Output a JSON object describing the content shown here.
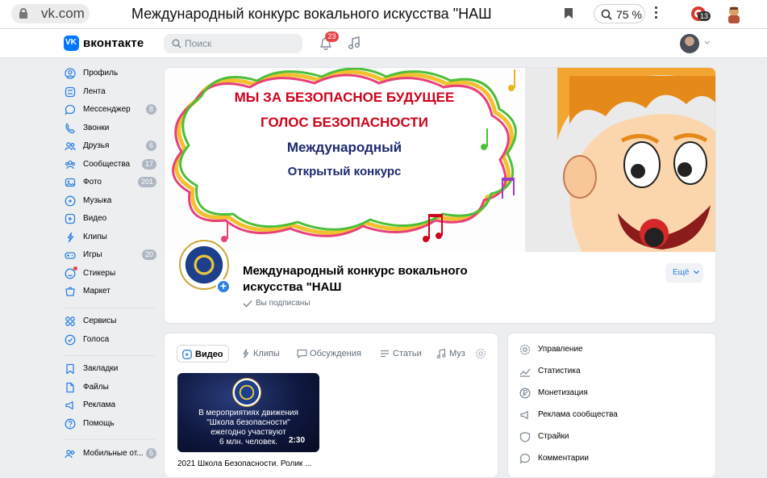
{
  "browser": {
    "url": "vk.com",
    "title": "Международный конкурс вокального искусства \"НАШ",
    "zoom": "75 %",
    "extension_badge": "13"
  },
  "header": {
    "brand": "вконтакте",
    "search_placeholder": "Поиск",
    "notifications_count": "23"
  },
  "nav": {
    "items": [
      {
        "label": "Профиль",
        "icon": "profile-icon"
      },
      {
        "label": "Лента",
        "icon": "feed-icon"
      },
      {
        "label": "Мессенджер",
        "icon": "messenger-icon",
        "count": "8"
      },
      {
        "label": "Звонки",
        "icon": "phone-icon"
      },
      {
        "label": "Друзья",
        "icon": "friends-icon",
        "count": "6"
      },
      {
        "label": "Сообщества",
        "icon": "communities-icon",
        "count": "17"
      },
      {
        "label": "Фото",
        "icon": "photo-icon",
        "count": "201"
      },
      {
        "label": "Музыка",
        "icon": "music-icon"
      },
      {
        "label": "Видео",
        "icon": "video-icon"
      },
      {
        "label": "Клипы",
        "icon": "clips-icon"
      },
      {
        "label": "Игры",
        "icon": "games-icon",
        "count": "20"
      },
      {
        "label": "Стикеры",
        "icon": "stickers-icon"
      },
      {
        "label": "Маркет",
        "icon": "market-icon"
      },
      {
        "label": "Сервисы",
        "icon": "services-icon"
      },
      {
        "label": "Голоса",
        "icon": "votes-icon"
      },
      {
        "label": "Закладки",
        "icon": "bookmarks-icon"
      },
      {
        "label": "Файлы",
        "icon": "files-icon"
      },
      {
        "label": "Реклама",
        "icon": "ads-icon"
      },
      {
        "label": "Помощь",
        "icon": "help-icon"
      },
      {
        "label": "Мобильные от...",
        "icon": "mobile-icon",
        "count": "5"
      }
    ]
  },
  "cover": {
    "line1": "МЫ ЗА БЕЗОПАСНОЕ БУДУЩЕЕ",
    "line2": "ГОЛОС БЕЗОПАСНОСТИ",
    "line3": "Международный",
    "line4": "Открытый конкурс"
  },
  "community": {
    "name": "Международный конкурс вокального искусства \"НАШ",
    "status": "Вы подписаны",
    "more_label": "Ещё"
  },
  "content": {
    "tabs": [
      {
        "label": "Видео",
        "active": true
      },
      {
        "label": "Клипы"
      },
      {
        "label": "Обсуждения"
      },
      {
        "label": "Статьи"
      },
      {
        "label": "Муз"
      }
    ],
    "video": {
      "caption_line1": "В мероприятиях движения",
      "caption_line2": "\"Школа безопасности\"",
      "caption_line3": "ежегодно участвуют",
      "caption_line4": "6 млн. человек.",
      "duration": "2:30",
      "title": "2021 Школа Безопасности. Ролик ..."
    }
  },
  "manage": {
    "items": [
      {
        "label": "Управление",
        "icon": "gear-icon"
      },
      {
        "label": "Статистика",
        "icon": "stats-icon"
      },
      {
        "label": "Монетизация",
        "icon": "ruble-icon"
      },
      {
        "label": "Реклама сообщества",
        "icon": "megaphone-icon"
      },
      {
        "label": "Страйки",
        "icon": "strikes-icon"
      },
      {
        "label": "Комментарии",
        "icon": "comments-icon"
      }
    ]
  },
  "colors": {
    "accent": "#2d81e0",
    "vk_blue": "#0077ff",
    "badge_red": "#e64646",
    "page_bg": "#edeef0"
  }
}
